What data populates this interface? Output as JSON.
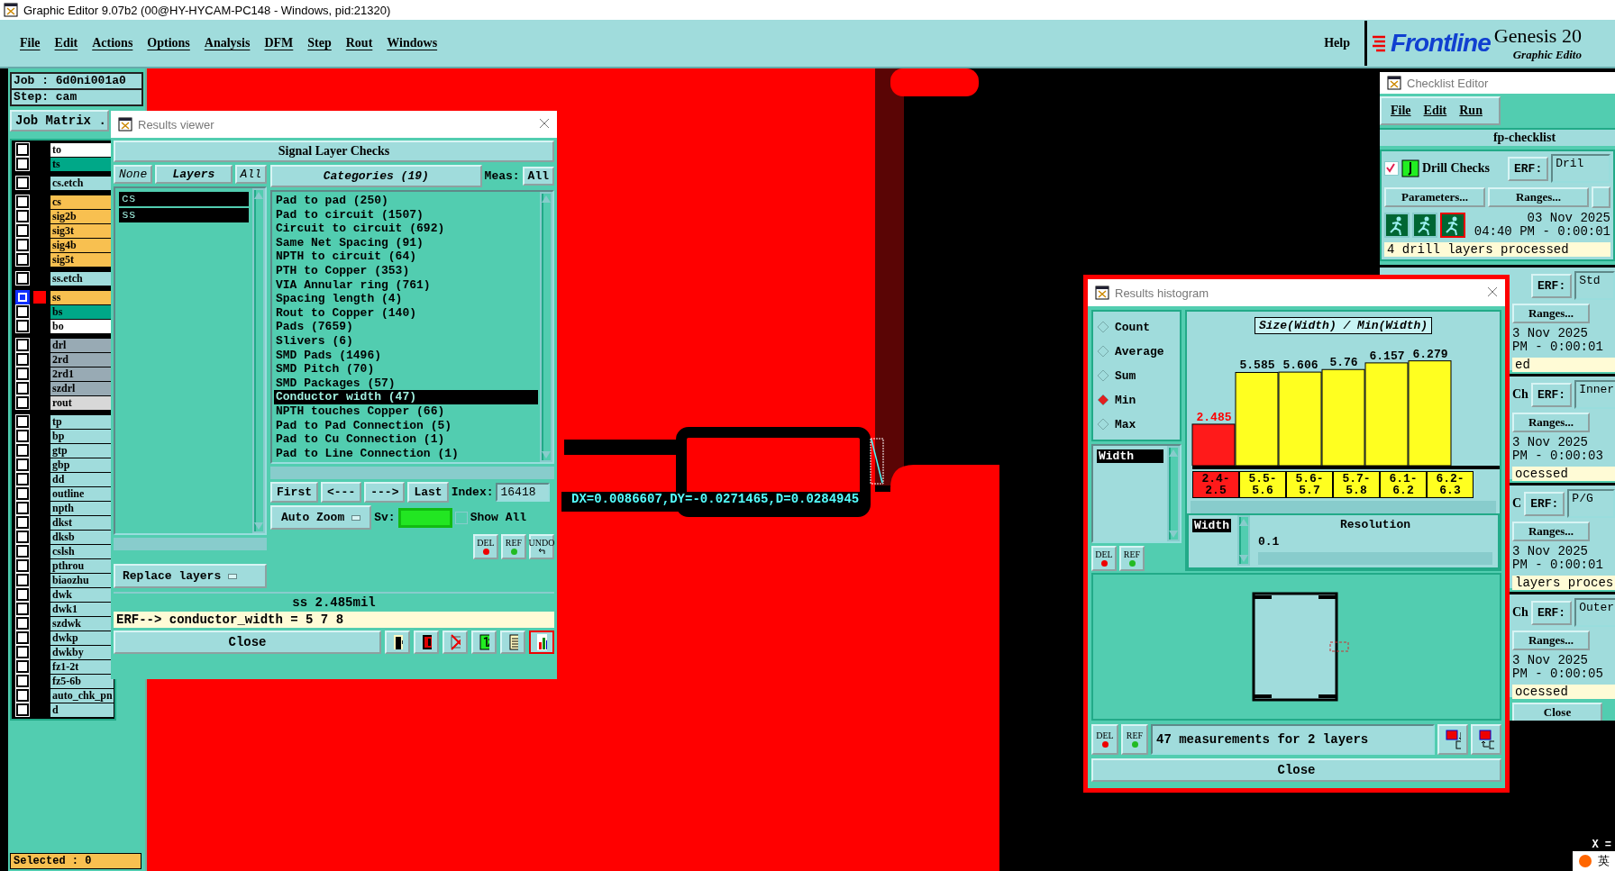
{
  "window": {
    "title": "Graphic Editor 9.07b2 (00@HY-HYCAM-PC148 - Windows, pid:21320)"
  },
  "menu": [
    "File",
    "Edit",
    "Actions",
    "Options",
    "Analysis",
    "DFM",
    "Step",
    "Rout",
    "Windows"
  ],
  "help": "Help",
  "brand": {
    "logo": "Frontline",
    "product": "Genesis 20",
    "subtitle": "Graphic Edito"
  },
  "job_panel": {
    "job": "Job : 6d0ni001a0",
    "step": "Step: cam",
    "matrix_button": "Job Matrix .",
    "layer_groups": [
      [
        {
          "name": "to",
          "color": "#ffffff",
          "selected": false
        },
        {
          "name": "ts",
          "color": "#00a888",
          "selected": false
        }
      ],
      [
        {
          "name": "cs.etch",
          "color": "#a0dcdc",
          "selected": false
        }
      ],
      [
        {
          "name": "cs",
          "color": "#f8c050",
          "selected": false
        },
        {
          "name": "sig2b",
          "color": "#f8c050",
          "selected": false
        },
        {
          "name": "sig3t",
          "color": "#f8c050",
          "selected": false
        },
        {
          "name": "sig4b",
          "color": "#f8c050",
          "selected": false
        },
        {
          "name": "sig5t",
          "color": "#f8c050",
          "selected": false
        }
      ],
      [
        {
          "name": "ss.etch",
          "color": "#a0dcdc",
          "selected": false
        }
      ],
      [
        {
          "name": "ss",
          "color": "#f8c050",
          "selected": true
        },
        {
          "name": "bs",
          "color": "#00a888",
          "selected": false
        },
        {
          "name": "bo",
          "color": "#ffffff",
          "selected": false
        }
      ],
      [
        {
          "name": "drl",
          "color": "#98aab4",
          "selected": false
        },
        {
          "name": "2rd",
          "color": "#98aab4",
          "selected": false
        },
        {
          "name": "2rd1",
          "color": "#98aab4",
          "selected": false
        },
        {
          "name": "szdrl",
          "color": "#98aab4",
          "selected": false
        },
        {
          "name": "rout",
          "color": "#d8d8d8",
          "selected": false
        }
      ],
      [
        {
          "name": "tp",
          "color": "#a0dcdc",
          "selected": false
        },
        {
          "name": "bp",
          "color": "#a0dcdc",
          "selected": false
        },
        {
          "name": "gtp",
          "color": "#a0dcdc",
          "selected": false
        },
        {
          "name": "gbp",
          "color": "#a0dcdc",
          "selected": false
        },
        {
          "name": "dd",
          "color": "#a0dcdc",
          "selected": false
        },
        {
          "name": "outline",
          "color": "#a0dcdc",
          "selected": false
        },
        {
          "name": "npth",
          "color": "#a0dcdc",
          "selected": false
        },
        {
          "name": "dkst",
          "color": "#a0dcdc",
          "selected": false
        },
        {
          "name": "dksb",
          "color": "#a0dcdc",
          "selected": false
        },
        {
          "name": "cslsh",
          "color": "#a0dcdc",
          "selected": false
        },
        {
          "name": "pthrou",
          "color": "#a0dcdc",
          "selected": false
        },
        {
          "name": "biaozhu",
          "color": "#a0dcdc",
          "selected": false
        },
        {
          "name": "dwk",
          "color": "#a0dcdc",
          "selected": false
        },
        {
          "name": "dwk1",
          "color": "#a0dcdc",
          "selected": false
        },
        {
          "name": "szdwk",
          "color": "#a0dcdc",
          "selected": false
        },
        {
          "name": "dwkp",
          "color": "#a0dcdc",
          "selected": false
        },
        {
          "name": "dwkby",
          "color": "#a0dcdc",
          "selected": false
        },
        {
          "name": "fz1-2t",
          "color": "#a0dcdc",
          "selected": false
        },
        {
          "name": "fz5-6b",
          "color": "#a0dcdc",
          "selected": false
        },
        {
          "name": "auto_chk_pn",
          "color": "#a0dcdc",
          "selected": false
        },
        {
          "name": "d",
          "color": "#a0dcdc",
          "selected": false
        }
      ]
    ],
    "selected_count": "Selected : 0"
  },
  "canvas": {
    "measurement": "DX=0.0086607,DY=-0.0271465,D=0.0284945"
  },
  "results_viewer": {
    "title": "Results viewer",
    "header": "Signal Layer Checks",
    "layer_buttons": [
      "None",
      "Layers",
      "All"
    ],
    "layers": [
      {
        "name": "cs",
        "selected": true
      },
      {
        "name": "ss",
        "selected": true
      }
    ],
    "categories_button": "Categories (19)",
    "meas_label": "Meas:",
    "meas_value": "All",
    "categories": [
      {
        "label": "Pad to pad (250)",
        "selected": false
      },
      {
        "label": "Pad to circuit (1507)",
        "selected": false
      },
      {
        "label": "Circuit to circuit (692)",
        "selected": false
      },
      {
        "label": "Same Net Spacing (91)",
        "selected": false
      },
      {
        "label": "NPTH to circuit (64)",
        "selected": false
      },
      {
        "label": "PTH to Copper (353)",
        "selected": false
      },
      {
        "label": "VIA Annular ring (761)",
        "selected": false
      },
      {
        "label": "Spacing length (4)",
        "selected": false
      },
      {
        "label": "Rout to Copper (140)",
        "selected": false
      },
      {
        "label": "Pads (7659)",
        "selected": false
      },
      {
        "label": "Slivers (6)",
        "selected": false
      },
      {
        "label": "SMD Pads (1496)",
        "selected": false
      },
      {
        "label": "SMD Pitch (70)",
        "selected": false
      },
      {
        "label": "SMD Packages (57)",
        "selected": false
      },
      {
        "label": "Conductor width (47)",
        "selected": true
      },
      {
        "label": "NPTH touches Copper (66)",
        "selected": false
      },
      {
        "label": "Pad to Pad Connection (5)",
        "selected": false
      },
      {
        "label": "Pad to Cu Connection (1)",
        "selected": false
      },
      {
        "label": "Pad to Line Connection (1)",
        "selected": false
      }
    ],
    "nav": [
      "First",
      "<---",
      "--->",
      "Last"
    ],
    "index_label": "Index:",
    "index_value": "16418",
    "auto_zoom": "Auto Zoom",
    "sv_label": "Sv:",
    "show_all": {
      "label": "Show All",
      "checked": false
    },
    "replace_layers": "Replace layers",
    "tool_buttons": [
      "DEL",
      "REF",
      "UNDO"
    ],
    "status": "ss 2.485mil",
    "erf": "ERF--> conductor_width = 5 7 8",
    "close": "Close",
    "bottom_tools": [
      {
        "kind": "layers",
        "selected": false
      },
      {
        "kind": "board",
        "selected": false
      },
      {
        "kind": "ref-off",
        "selected": false
      },
      {
        "kind": "counter",
        "selected": false
      },
      {
        "kind": "report",
        "selected": false
      },
      {
        "kind": "histogram",
        "selected": true
      }
    ]
  },
  "histogram": {
    "title": "Results histogram",
    "modes": [
      {
        "label": "Count",
        "selected": false
      },
      {
        "label": "Average",
        "selected": false
      },
      {
        "label": "Sum",
        "selected": false
      },
      {
        "label": "Min",
        "selected": true
      },
      {
        "label": "Max",
        "selected": false
      }
    ],
    "fields": [
      {
        "label": "Width",
        "selected": true
      }
    ],
    "chart_data": {
      "type": "bar",
      "title": "Size(Width) / Min(Width)",
      "categories": [
        "2.4-2.5",
        "5.5-5.6",
        "5.6-5.7",
        "5.7-5.8",
        "6.1-6.2",
        "6.2-6.3"
      ],
      "series": [
        {
          "color": "#ff1a1a",
          "values": [
            2.485,
            null,
            null,
            null,
            null,
            null
          ]
        },
        {
          "color": "#ffff20",
          "values": [
            null,
            5.585,
            5.606,
            5.76,
            6.157,
            6.279
          ]
        }
      ],
      "data_labels": true
    },
    "x_field": "Width",
    "resolution_label": "Resolution",
    "resolution_value": "0.1",
    "buttons": [
      "DEL",
      "REF"
    ],
    "summary_buttons": [
      "DEL",
      "REF"
    ],
    "summary": "47 measurements for 2 layers",
    "close": "Close"
  },
  "checklist": {
    "title": "Checklist Editor",
    "menu": [
      "File",
      "Edit",
      "Run"
    ],
    "name": "fp-checklist",
    "first": {
      "checked": true,
      "name": "Drill Checks",
      "erf_label": "ERF:",
      "erf_value": "Dril",
      "buttons": [
        "Parameters...",
        "Ranges..."
      ],
      "date": "03 Nov 2025",
      "time": "04:40 PM - 0:00:01",
      "status": "4 drill layers processed"
    },
    "others": [
      {
        "erf_label": "ERF:",
        "erf_value": "Std",
        "button": "Ranges...",
        "date": "3 Nov 2025",
        "time": "PM - 0:00:01",
        "status": "ed"
      },
      {
        "name": "Ch",
        "erf_label": "ERF:",
        "erf_value": "Inner",
        "button": "Ranges...",
        "date": "3 Nov 2025",
        "time": "PM - 0:00:03",
        "status": "ocessed"
      },
      {
        "name": "C",
        "erf_label": "ERF:",
        "erf_value": "P/G",
        "button": "Ranges...",
        "date": "3 Nov 2025",
        "time": "PM - 0:00:01",
        "status": "layers proces"
      },
      {
        "name": "Ch",
        "erf_label": "ERF:",
        "erf_value": "Outer",
        "button": "Ranges...",
        "date": "3 Nov 2025",
        "time": "PM - 0:00:05",
        "status": "ocessed"
      }
    ],
    "close": "Close"
  },
  "corner": {
    "x_label": "X =",
    "ime": "英"
  }
}
